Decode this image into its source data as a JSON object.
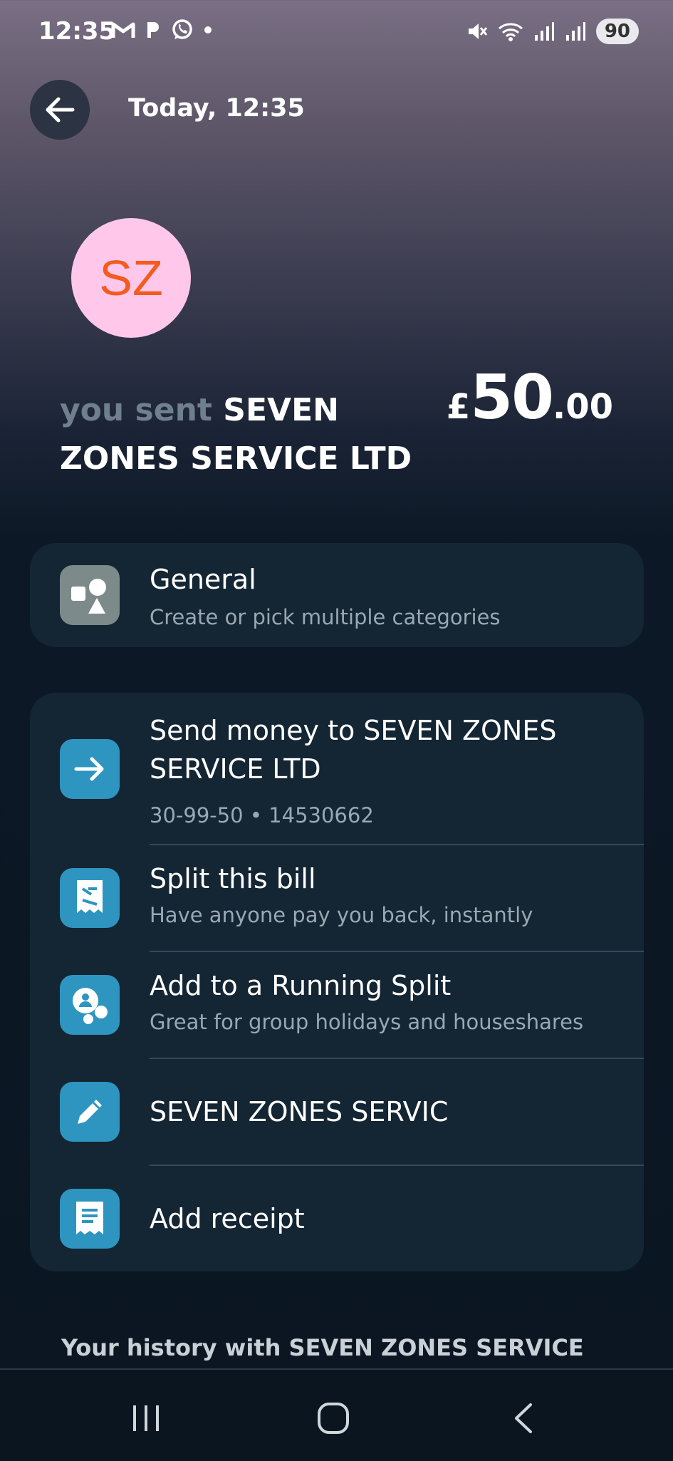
{
  "status_bar": {
    "time": "12:35",
    "left_icons": [
      "gmail-icon",
      "notification-icon",
      "whatsapp-icon",
      "dot-icon"
    ],
    "right_icons": [
      "mute-icon",
      "wifi-icon",
      "signal-icon",
      "signal-icon"
    ],
    "battery": "90"
  },
  "header": {
    "title": "Today, 12:35"
  },
  "avatar": {
    "initials": "SZ",
    "bg_color": "#ffc8ea",
    "text_color": "#f35b1f"
  },
  "transaction": {
    "prefix": "you sent",
    "payee": "SEVEN ZONES SERVICE LTD",
    "currency": "£",
    "amount_whole": "50",
    "amount_decimal": ".00"
  },
  "category": {
    "title": "General",
    "subtitle": "Create or pick multiple categories",
    "icon": "shapes-icon"
  },
  "actions": [
    {
      "title": "Send money to SEVEN ZONES SERVICE LTD",
      "subtitle": "30-99-50 • 14530662",
      "icon": "arrow-right-icon"
    },
    {
      "title": "Split this bill",
      "subtitle": "Have anyone pay you back, instantly",
      "icon": "split-bill-icon"
    },
    {
      "title": "Add to a Running Split",
      "subtitle": "Great for group holidays and houseshares",
      "icon": "group-icon"
    },
    {
      "title": "SEVEN ZONES SERVIC",
      "subtitle": "",
      "icon": "pencil-icon"
    },
    {
      "title": "Add receipt",
      "subtitle": "",
      "icon": "receipt-icon"
    }
  ],
  "history": {
    "label": "Your history with SEVEN ZONES SERVICE"
  },
  "colors": {
    "accent": "#2d95bf",
    "card": "#142533",
    "muted_text": "#6f7f8d"
  }
}
